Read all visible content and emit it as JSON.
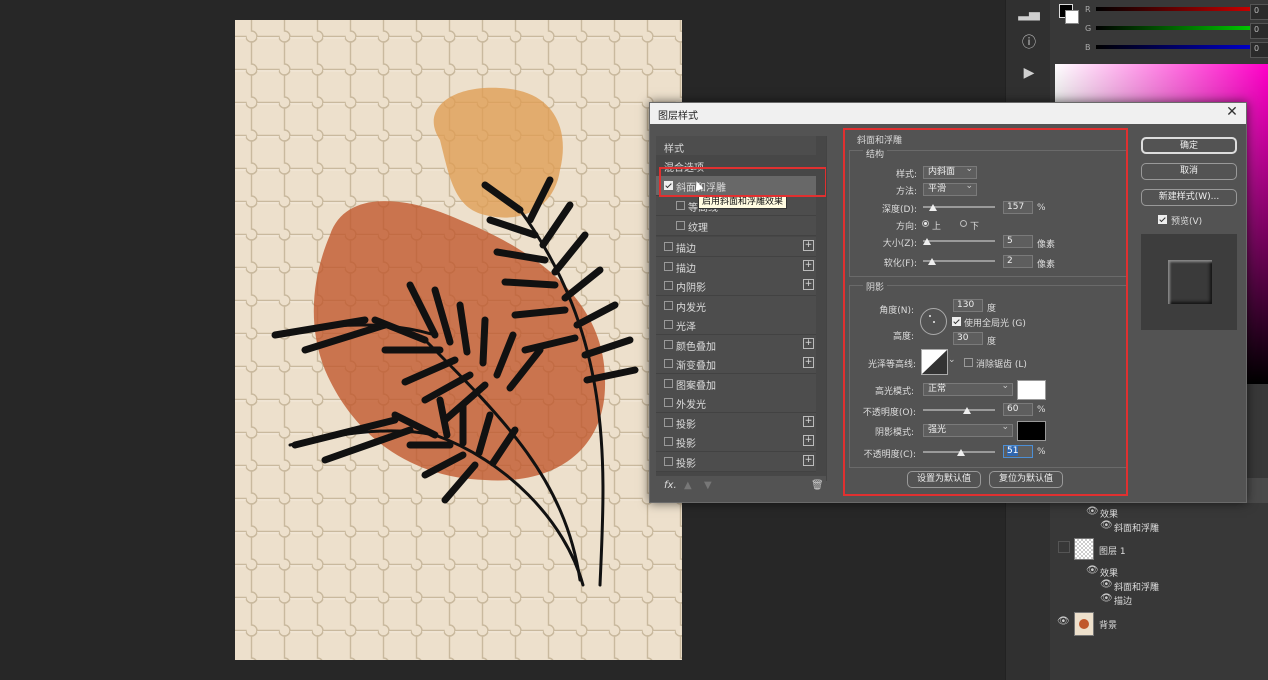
{
  "dialog": {
    "title": "图层样式",
    "close": "✕",
    "styles_label": "样式",
    "blend_label": "混合选项",
    "selected_item": "斜面和浮雕",
    "sub_items": [
      "等高线",
      "纹理"
    ],
    "tooltip": "启用斜面和浮雕效果",
    "items": [
      {
        "label": "描边",
        "plus": true
      },
      {
        "label": "描边",
        "plus": true
      },
      {
        "label": "内阴影",
        "plus": true
      },
      {
        "label": "内发光",
        "plus": false
      },
      {
        "label": "光泽",
        "plus": false
      },
      {
        "label": "颜色叠加",
        "plus": true
      },
      {
        "label": "渐变叠加",
        "plus": true
      },
      {
        "label": "图案叠加",
        "plus": false
      },
      {
        "label": "外发光",
        "plus": false
      },
      {
        "label": "投影",
        "plus": true
      },
      {
        "label": "投影",
        "plus": true
      },
      {
        "label": "投影",
        "plus": true
      }
    ],
    "fx_label": "fx."
  },
  "bevel": {
    "header": "斜面和浮雕",
    "structure": "结构",
    "style_label": "样式:",
    "style_value": "内斜面",
    "technique_label": "方法:",
    "technique_value": "平滑",
    "depth_label": "深度(D):",
    "depth_value": "157",
    "depth_unit": "%",
    "direction_label": "方向:",
    "dir_up": "上",
    "dir_down": "下",
    "size_label": "大小(Z):",
    "size_value": "5",
    "size_unit": "像素",
    "soften_label": "软化(F):",
    "soften_value": "2",
    "soften_unit": "像素"
  },
  "shading": {
    "header": "阴影",
    "angle_label": "角度(N):",
    "angle_value": "130",
    "angle_unit": "度",
    "global_light": "使用全局光 (G)",
    "altitude_label": "高度:",
    "altitude_value": "30",
    "altitude_unit": "度",
    "gloss_label": "光泽等高线:",
    "anti_alias": "消除锯齿 (L)",
    "highlight_label": "高光模式:",
    "highlight_value": "正常",
    "highlight_color": "#ffffff",
    "h_opacity_label": "不透明度(O):",
    "h_opacity_value": "60",
    "h_opacity_unit": "%",
    "shadow_label": "阴影模式:",
    "shadow_value": "强光",
    "shadow_color": "#000000",
    "s_opacity_label": "不透明度(C):",
    "s_opacity_value": "51",
    "s_opacity_unit": "%",
    "make_default": "设置为默认值",
    "reset_default": "复位为默认值"
  },
  "buttons": {
    "ok": "确定",
    "cancel": "取消",
    "new_style": "新建样式(W)...",
    "preview": "预览(V)"
  },
  "color_panel": {
    "r": "R",
    "g": "G",
    "b": "B",
    "r_val": "0",
    "g_val": "0",
    "b_val": "0"
  },
  "layers": {
    "effects1": "效果",
    "effect1_item": "斜面和浮雕",
    "layer1": "图层 1",
    "effects2": "效果",
    "effect2_item1": "斜面和浮雕",
    "effect2_item2": "描边",
    "background": "背景"
  },
  "colors": {
    "accent_red": "#e03030",
    "canvas_bg": "#ede0cc",
    "orange_blob": "#df9c52",
    "rust_blob": "#c0582c"
  }
}
